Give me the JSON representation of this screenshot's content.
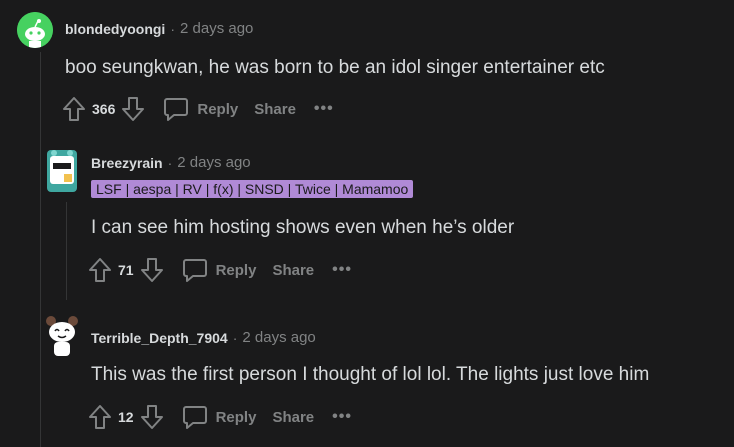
{
  "comments": [
    {
      "author": "blondedyoongi",
      "separator": "·",
      "time": "2 days ago",
      "flair": "",
      "text": "boo seungkwan, he was born to be an idol singer entertainer etc",
      "score": "366",
      "reply_label": "Reply",
      "share_label": "Share",
      "more_label": "•••"
    },
    {
      "author": "Breezyrain",
      "separator": "·",
      "time": "2 days ago",
      "flair": "LSF | aespa | RV | f(x) | SNSD | Twice | Mamamoo",
      "text": "I can see him hosting shows even when he’s older",
      "score": "71",
      "reply_label": "Reply",
      "share_label": "Share",
      "more_label": "•••"
    },
    {
      "author": "Terrible_Depth_7904",
      "separator": "·",
      "time": "2 days ago",
      "flair": "",
      "text": "This was the first person I thought of lol lol. The lights just love him",
      "score": "12",
      "reply_label": "Reply",
      "share_label": "Share",
      "more_label": "•••"
    }
  ],
  "colors": {
    "background": "#1a1a1b",
    "text": "#d7dadc",
    "muted": "#818384",
    "flair_bg": "#b08ad6",
    "avatar_green": "#46d160"
  },
  "icons": [
    "snoo-avatar-icon",
    "upvote-icon",
    "downvote-icon",
    "comment-bubble-icon"
  ]
}
